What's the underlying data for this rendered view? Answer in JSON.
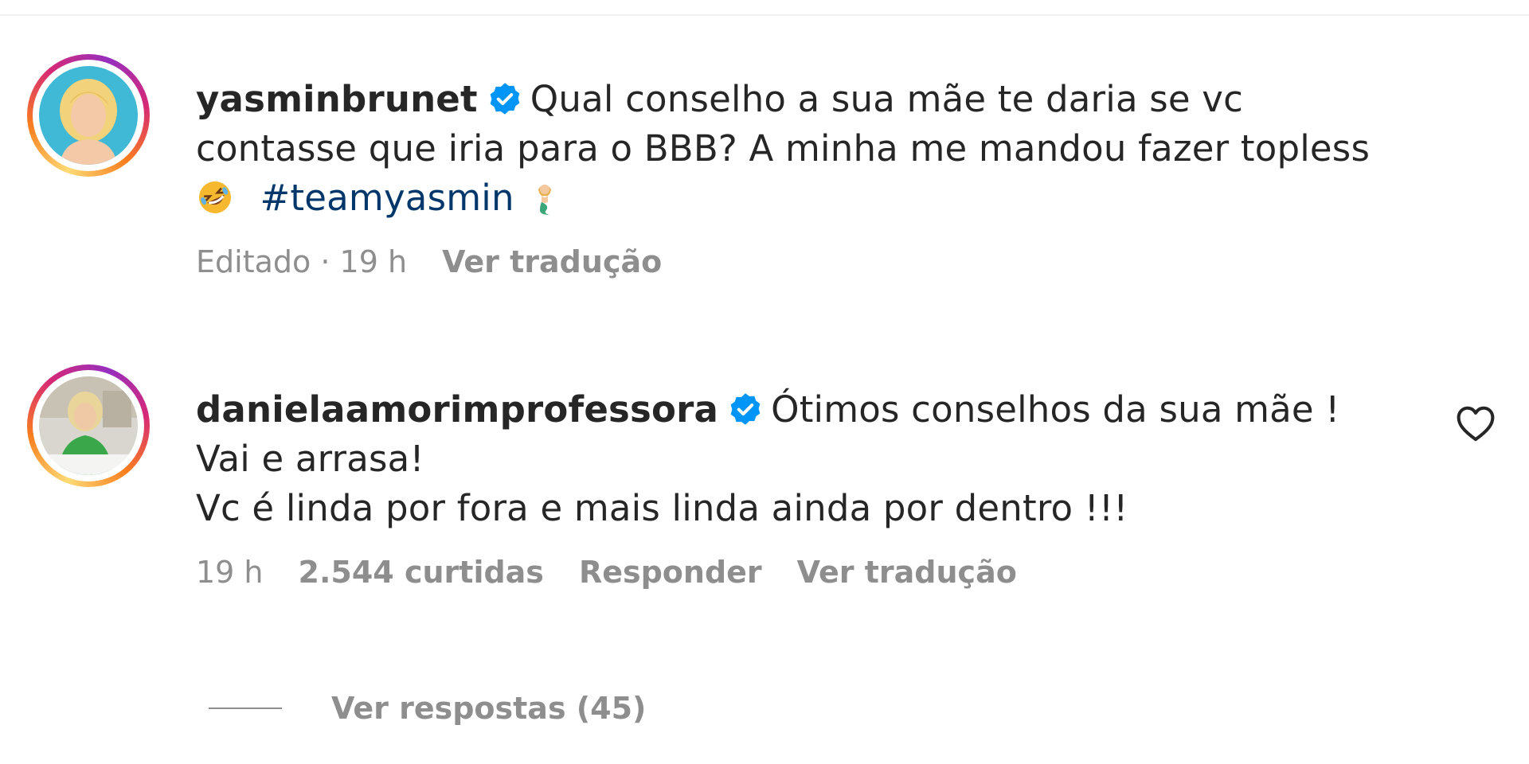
{
  "comments": [
    {
      "username": "yasminbrunet",
      "verified": true,
      "text_line1": "Qual conselho a sua mãe te daria se vc",
      "text_line2": "contasse que iria para o BBB? A minha me mandou fazer topless",
      "emoji1": "rolling-on-floor-laughing",
      "hashtag": "#teamyasmin",
      "emoji2": "mermaid",
      "edited_label": "Editado",
      "separator": "·",
      "time": "19 h",
      "translate_label": "Ver tradução"
    },
    {
      "username": "danielaamorimprofessora",
      "verified": true,
      "text_line1": "Ótimos conselhos da sua mãe !",
      "text_line2": "Vai e arrasa!",
      "text_line3": "Vc é linda por fora e mais linda ainda por dentro !!!",
      "time": "19 h",
      "likes": "2.544 curtidas",
      "reply_label": "Responder",
      "translate_label": "Ver tradução"
    }
  ],
  "view_replies_label": "Ver respostas (45)",
  "icons": {
    "verified": "verified-badge-icon",
    "like": "heart-outline-icon"
  },
  "colors": {
    "text": "#262626",
    "muted": "#8e8e8e",
    "hashtag": "#00376b",
    "verified": "#0095f6"
  }
}
